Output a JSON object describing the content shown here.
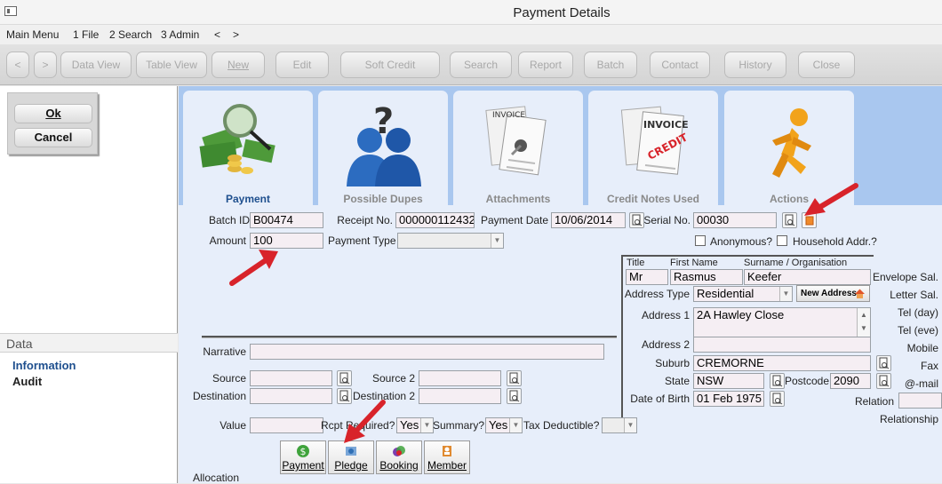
{
  "window": {
    "title": "Payment Details"
  },
  "menu": [
    "Main Menu",
    "1 File",
    "2 Search",
    "3 Admin",
    "<",
    ">"
  ],
  "toolbar": {
    "prev": "<",
    "next": ">",
    "buttons": [
      "Data View",
      "Table View",
      "New",
      "Edit",
      "Soft Credit",
      "Search",
      "Report",
      "Batch",
      "Contact",
      "History",
      "Close"
    ]
  },
  "dialog": {
    "ok": "Ok",
    "cancel": "Cancel"
  },
  "sidebar": {
    "header": "Data",
    "items": [
      "Information",
      "Audit"
    ]
  },
  "tabs": [
    "Payment",
    "Possible Dupes",
    "Attachments",
    "Credit Notes Used",
    "Actions"
  ],
  "payment": {
    "batch_id_label": "Batch ID",
    "batch_id": "B00474",
    "receipt_label": "Receipt No.",
    "receipt": "000000112432",
    "date_label": "Payment Date",
    "date": "10/06/2014",
    "serial_label": "Serial No.",
    "serial": "00030",
    "amount_label": "Amount",
    "amount": "100",
    "type_label": "Payment Type",
    "type": "",
    "anonymous_label": "Anonymous?",
    "household_label": "Household Addr.?",
    "narrative_label": "Narrative",
    "narrative": "",
    "source_label": "Source",
    "source2_label": "Source 2",
    "destination_label": "Destination",
    "destination2_label": "Destination 2",
    "value_label": "Value",
    "value": "",
    "rcpt_label": "Rcpt Required?",
    "rcpt": "Yes",
    "summary_label": "Summary?",
    "summary": "Yes",
    "tax_label": "Tax Deductible?",
    "tax": "",
    "allocation_label": "Allocation"
  },
  "contact": {
    "title_label": "Title",
    "first_label": "First Name",
    "surname_label": "Surname / Organisation",
    "title": "Mr",
    "first": "Rasmus",
    "surname": "Keefer",
    "addr_type_label": "Address Type",
    "addr_type": "Residential",
    "new_address": "New Address",
    "address1_label": "Address 1",
    "address1": "2A Hawley Close",
    "address2_label": "Address 2",
    "address2": "",
    "suburb_label": "Suburb",
    "suburb": "CREMORNE",
    "state_label": "State",
    "state": "NSW",
    "postcode_label": "Postcode",
    "postcode": "2090",
    "dob_label": "Date of Birth",
    "dob": "01 Feb 1975",
    "envelope_label": "Envelope Sal.",
    "letter_label": "Letter Sal.",
    "tel_day_label": "Tel (day)",
    "tel_eve_label": "Tel (eve)",
    "mobile_label": "Mobile",
    "fax_label": "Fax",
    "email_label": "@-mail",
    "relation_label": "Relation",
    "relationship_label": "Relationship"
  },
  "allocation_buttons": [
    "Payment",
    "Pledge",
    "Booking",
    "Member"
  ],
  "colors": {
    "tab_strip": "#a9c7ef",
    "panel": "#e7eefa",
    "field": "#f5eef3",
    "arrow": "#d8232a",
    "active_tab": "#1e4f8e"
  }
}
